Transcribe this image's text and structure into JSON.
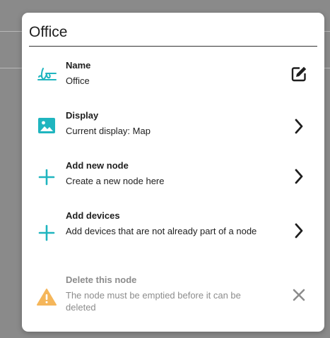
{
  "dialog": {
    "title": "Office",
    "items": [
      {
        "label": "Name",
        "description": "Office",
        "icon": "signature-icon",
        "action_icon": "edit-icon"
      },
      {
        "label": "Display",
        "description": "Current display: Map",
        "icon": "image-icon",
        "action_icon": "chevron-right-icon"
      },
      {
        "label": "Add new node",
        "description": "Create a new node here",
        "icon": "plus-icon",
        "action_icon": "chevron-right-icon"
      },
      {
        "label": "Add devices",
        "description": "Add devices that are not already part of a node",
        "icon": "plus-icon",
        "action_icon": "chevron-right-icon"
      },
      {
        "label": "Delete this node",
        "description": "The node must be emptied before it can be deleted",
        "icon": "warning-icon",
        "action_icon": "close-icon",
        "disabled": true
      }
    ]
  },
  "colors": {
    "accent": "#1fb5bf",
    "warning": "#f5b65a",
    "disabled": "#8c8c8c",
    "text": "#1e1e1e"
  }
}
